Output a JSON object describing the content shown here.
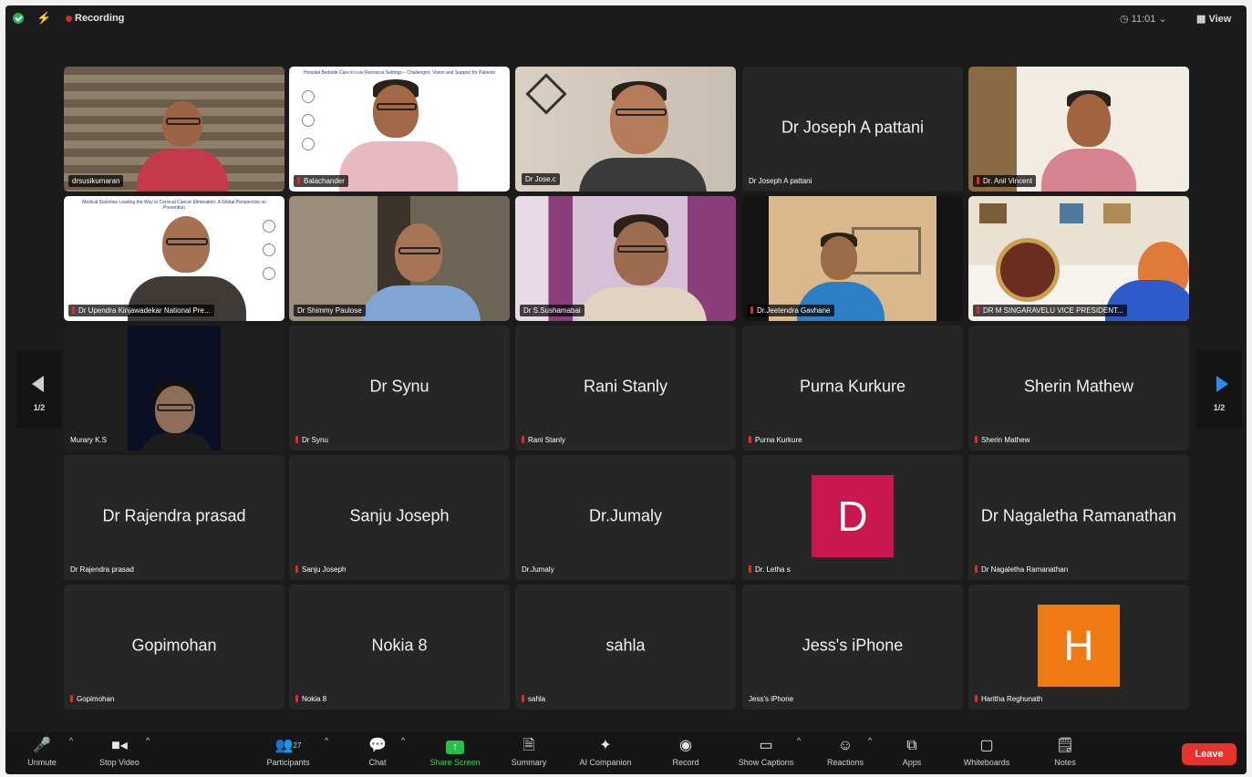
{
  "topbar": {
    "recording_label": "Recording",
    "clock": "11:01",
    "view_label": "View"
  },
  "pager": {
    "left_page": "1/2",
    "right_page": "1/2"
  },
  "tiles": [
    {
      "name": "drsusikumaran",
      "display": ""
    },
    {
      "name": "Balachander",
      "display": "",
      "slide_title": "Hospital Bedside Care in Low Resource Settings – Challenges, Vision and Support for Patients"
    },
    {
      "name": "Dr Jose.c",
      "display": ""
    },
    {
      "name": "Dr  Joseph A pattani",
      "display": "Dr  Joseph A pattani"
    },
    {
      "name": "Dr. Anil Vincent",
      "display": ""
    },
    {
      "name": "Dr Upendra Kinjawadekar National Pre...",
      "display": "",
      "slide_title": "Medical Societies Leading the Way to Cervical Cancer Elimination: A Global Perspective on Prevention"
    },
    {
      "name": "Dr Shimmy Paulose",
      "display": ""
    },
    {
      "name": "Dr S.Sushamabai",
      "display": ""
    },
    {
      "name": "Dr.Jeetendra Gavhane",
      "display": ""
    },
    {
      "name": "DR M SINGARAVELU VICE PRESIDENT...",
      "display": ""
    },
    {
      "name": "Murary K.S",
      "display": ""
    },
    {
      "name": "Dr Synu",
      "display": "Dr Synu"
    },
    {
      "name": "Rani Stanly",
      "display": "Rani Stanly"
    },
    {
      "name": "Purna Kurkure",
      "display": "Purna Kurkure"
    },
    {
      "name": "Sherin Mathew",
      "display": "Sherin Mathew"
    },
    {
      "name": "Dr Rajendra prasad",
      "display": "Dr Rajendra prasad"
    },
    {
      "name": "Sanju Joseph",
      "display": "Sanju Joseph"
    },
    {
      "name": "Dr.Jumaly",
      "display": "Dr.Jumaly"
    },
    {
      "name": "Dr. Letha s",
      "display": "",
      "avatar_letter": "D",
      "avatar_color": "#c8184f"
    },
    {
      "name": "Dr Nagaletha Ramanathan",
      "display": "Dr Nagaletha Ramanathan"
    },
    {
      "name": "Gopimohan",
      "display": "Gopimohan"
    },
    {
      "name": "Nokia 8",
      "display": "Nokia 8"
    },
    {
      "name": "sahla",
      "display": "sahla"
    },
    {
      "name": "Jess's iPhone",
      "display": "Jess's iPhone"
    },
    {
      "name": "Haritha Reghunath",
      "display": "",
      "avatar_letter": "H",
      "avatar_color": "#f07a12"
    }
  ],
  "toolbar": {
    "unmute": "Unmute",
    "stop_video": "Stop Video",
    "participants": "Participants",
    "participants_count": "27",
    "chat": "Chat",
    "share_screen": "Share Screen",
    "summary": "Summary",
    "ai_companion": "AI Companion",
    "record": "Record",
    "show_captions": "Show Captions",
    "reactions": "Reactions",
    "apps": "Apps",
    "whiteboards": "Whiteboards",
    "notes": "Notes",
    "leave": "Leave"
  },
  "colors": {
    "active_speaker_border": "#2fbf4a",
    "leave_button": "#e5322b",
    "share_screen": "#27c04a",
    "mute_indicator": "#e52a2a",
    "pager_arrow_active": "#2b8be8"
  }
}
